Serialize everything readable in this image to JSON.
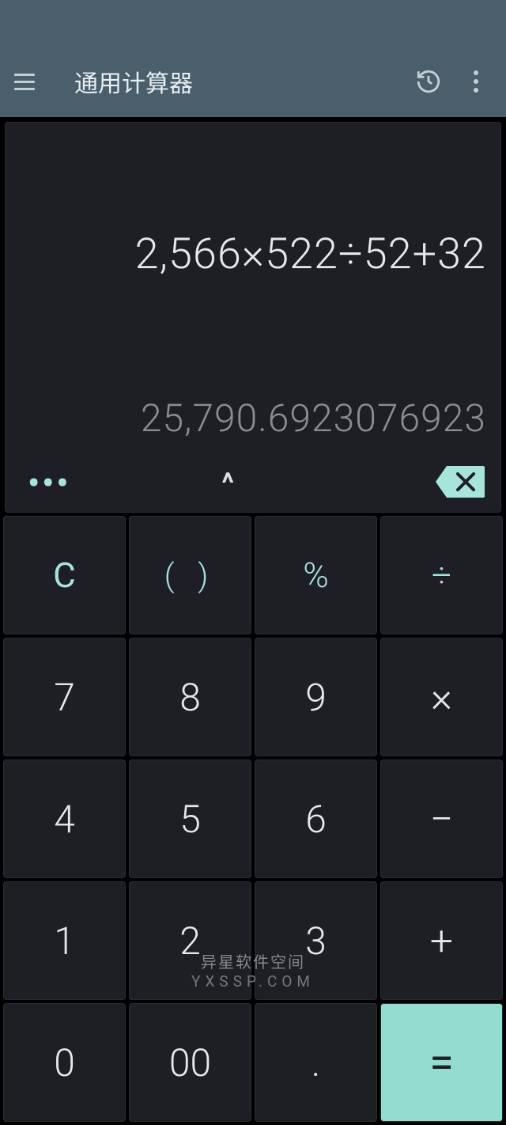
{
  "header": {
    "title": "通用计算器"
  },
  "display": {
    "expression": "2,566×522÷52+32",
    "result": "25,790.6923076923",
    "more_dots": "•••",
    "caret": "^"
  },
  "keys": {
    "clear": "C",
    "paren": "( )",
    "percent": "%",
    "divide": "÷",
    "k7": "7",
    "k8": "8",
    "k9": "9",
    "multiply": "×",
    "k4": "4",
    "k5": "5",
    "k6": "6",
    "minus": "−",
    "k1": "1",
    "k2": "2",
    "k3": "3",
    "plus": "+",
    "k0": "0",
    "k00": "00",
    "dot": ".",
    "equals": "="
  },
  "watermark": {
    "cn": "异星软件空间",
    "en": "YXSSP.COM"
  }
}
